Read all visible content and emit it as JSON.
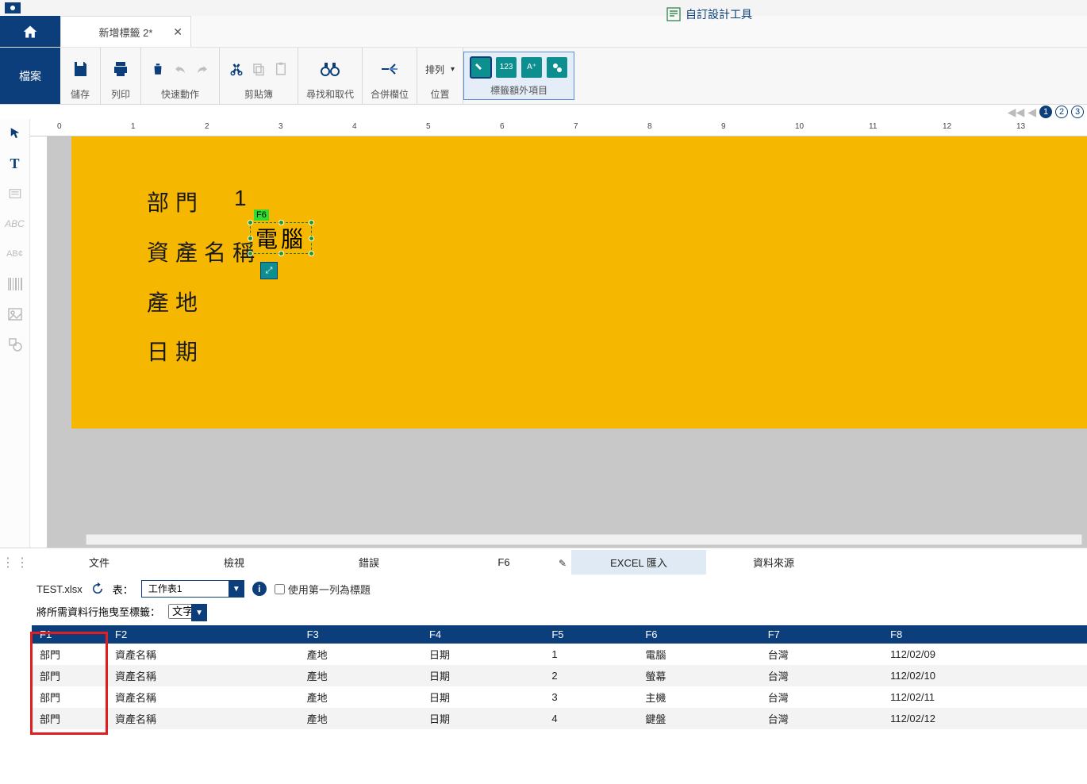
{
  "top_link": "自訂設計工具",
  "tabs": {
    "document": "新增標籤 2*"
  },
  "file_button": "檔案",
  "ribbon": {
    "save": "儲存",
    "print": "列印",
    "quick_action": "快速動作",
    "clipboard": "剪貼簿",
    "find_replace": "尋找和取代",
    "merge_field": "合併欄位",
    "arrange": "排列",
    "position": "位置",
    "tag_extra": "標籤額外項目"
  },
  "pager": {
    "pages": [
      "1",
      "2",
      "3"
    ],
    "active": 0
  },
  "canvas": {
    "labels": {
      "dept": "部門",
      "dept_val": "1",
      "asset": "資產名稱",
      "asset_val": "電腦",
      "origin": "產地",
      "date": "日期"
    },
    "selected_field": "F6"
  },
  "bottom_tabs": {
    "document": "文件",
    "view": "檢視",
    "error": "錯誤",
    "field": "F6",
    "excel_import": "EXCEL 匯入",
    "data_source": "資料來源"
  },
  "excel": {
    "filename": "TEST.xlsx",
    "table_label": "表：",
    "sheet": "工作表1",
    "use_first_row_label": "使用第一列為標題",
    "drag_label": "將所需資料行拖曳至標籤：",
    "drag_type": "文字",
    "headers": [
      "F1",
      "F2",
      "F3",
      "F4",
      "F5",
      "F6",
      "F7",
      "F8"
    ],
    "rows": [
      [
        "部門",
        "資產名稱",
        "產地",
        "日期",
        "1",
        "電腦",
        "台灣",
        "112/02/09"
      ],
      [
        "部門",
        "資產名稱",
        "產地",
        "日期",
        "2",
        "螢幕",
        "台灣",
        "112/02/10"
      ],
      [
        "部門",
        "資產名稱",
        "產地",
        "日期",
        "3",
        "主機",
        "台灣",
        "112/02/11"
      ],
      [
        "部門",
        "資產名稱",
        "產地",
        "日期",
        "4",
        "鍵盤",
        "台灣",
        "112/02/12"
      ]
    ]
  }
}
